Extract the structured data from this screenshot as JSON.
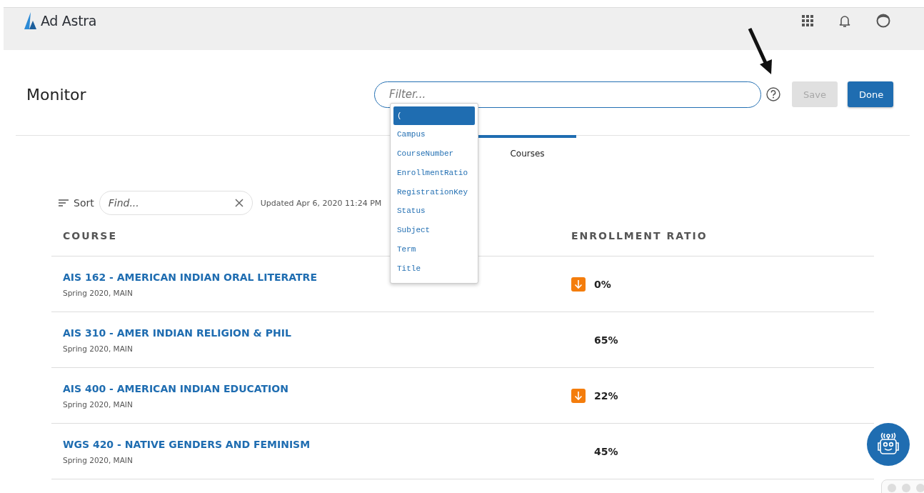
{
  "header": {
    "brand": "Ad Astra"
  },
  "page": {
    "title": "Monitor"
  },
  "filter": {
    "placeholder": "Filter..."
  },
  "buttons": [
    {
      "label": "Save",
      "disabled": true
    },
    {
      "label": "Done",
      "disabled": false
    }
  ],
  "filter_suggestions": [
    {
      "label": "(",
      "selected": true
    },
    {
      "label": "Campus",
      "selected": false
    },
    {
      "label": "CourseNumber",
      "selected": false
    },
    {
      "label": "EnrollmentRatio",
      "selected": false
    },
    {
      "label": "RegistrationKey",
      "selected": false
    },
    {
      "label": "Status",
      "selected": false
    },
    {
      "label": "Subject",
      "selected": false
    },
    {
      "label": "Term",
      "selected": false
    },
    {
      "label": "Title",
      "selected": false
    }
  ],
  "tabs": [
    {
      "label": "Courses",
      "selected": true
    }
  ],
  "toolbar": {
    "sort": "Sort",
    "find_placeholder": "Find...",
    "updated": "Updated Apr 6, 2020 11:24 PM"
  },
  "table": {
    "columns": [
      "COURSE",
      "ENROLLMENT RATIO"
    ],
    "rows": [
      {
        "course": "AIS 162 - AMERICAN INDIAN ORAL LITERATRE",
        "term": "Spring 2020, MAIN",
        "ratio": "0%",
        "trend_down": true
      },
      {
        "course": "AIS 310 - AMER INDIAN RELIGION & PHIL",
        "term": "Spring 2020, MAIN",
        "ratio": "65%",
        "trend_down": false
      },
      {
        "course": "AIS 400 - AMERICAN INDIAN EDUCATION",
        "term": "Spring 2020, MAIN",
        "ratio": "22%",
        "trend_down": true
      },
      {
        "course": "WGS 420 - NATIVE GENDERS AND FEMINISM",
        "term": "Spring 2020, MAIN",
        "ratio": "45%",
        "trend_down": false
      }
    ]
  }
}
